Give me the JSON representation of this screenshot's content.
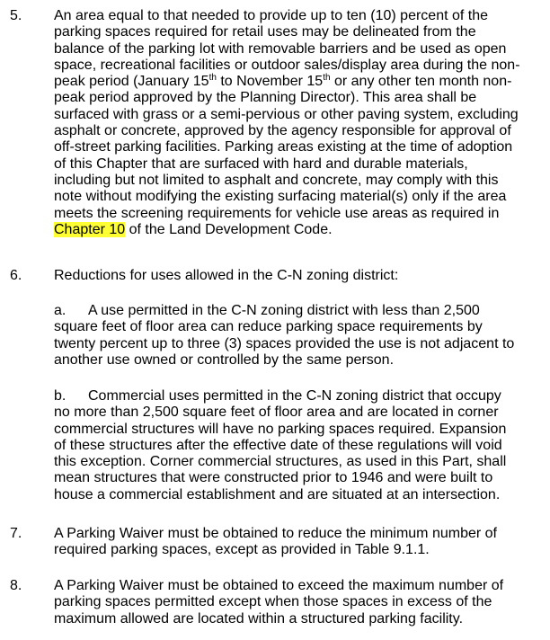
{
  "items": {
    "i5": {
      "number": "5.",
      "l1": "An area equal to that needed to provide up to ten (10) percent of the",
      "l2": "parking spaces required for retail uses may be delineated from the",
      "l3": "balance of the parking lot with removable barriers and be used as open",
      "l4": "space, recreational facilities or outdoor sales/display area during the non-",
      "l5a": "peak period (January 15",
      "l5sup1": "th",
      "l5b": " to November 15",
      "l5sup2": "th",
      "l5c": " or any other ten month non-",
      "l6": "peak period approved by the Planning Director).  This area shall be",
      "l7": "surfaced with grass or a semi-pervious or other paving system, excluding",
      "l8": "asphalt or concrete, approved by the agency responsible for approval of",
      "l9": "off-street parking facilities.  Parking areas existing at the time of adoption",
      "l10": "of this Chapter that are surfaced with hard and durable materials,",
      "l11": "including but not limited to asphalt and concrete, may comply with this",
      "l12": "note without modifying the existing surfacing material(s) only if the area",
      "l13": "meets the screening requirements for vehicle use areas as required in",
      "l14link": "Chapter 10",
      "l14": " of the Land Development Code."
    },
    "i6": {
      "number": "6.",
      "intro": "Reductions for uses allowed in the C-N zoning district:",
      "a": {
        "label": "a.",
        "l1": "A use permitted in the C-N zoning district with less than 2,500",
        "l2": "square feet of floor area can reduce parking space requirements by",
        "l3": "twenty percent up to three (3) spaces provided the use is not adjacent to",
        "l4": "another use owned or controlled by the same person."
      },
      "b": {
        "label": "b.",
        "l1": "Commercial uses permitted in the C-N zoning district that occupy",
        "l2": "no more than 2,500 square feet of floor area and are located in corner",
        "l3": "commercial structures will have no parking spaces required. Expansion",
        "l4": "of these structures after the effective date of these regulations will void",
        "l5": "this exception.  Corner commercial structures, as used in this Part, shall",
        "l6": "mean structures that were constructed prior to 1946 and were built to",
        "l7": "house a commercial establishment and are situated at an intersection."
      }
    },
    "i7": {
      "number": "7.",
      "l1": "A Parking Waiver must be obtained to reduce the minimum number of",
      "l2": "required parking spaces, except as provided in Table 9.1.1."
    },
    "i8": {
      "number": "8.",
      "l1": "A Parking Waiver must be obtained to exceed the maximum number of",
      "l2": "parking spaces permitted except when those spaces in excess of the",
      "l3": "maximum allowed are located within a structured parking facility."
    }
  },
  "colors": {
    "highlight": "#ffff33",
    "text": "#000000"
  }
}
